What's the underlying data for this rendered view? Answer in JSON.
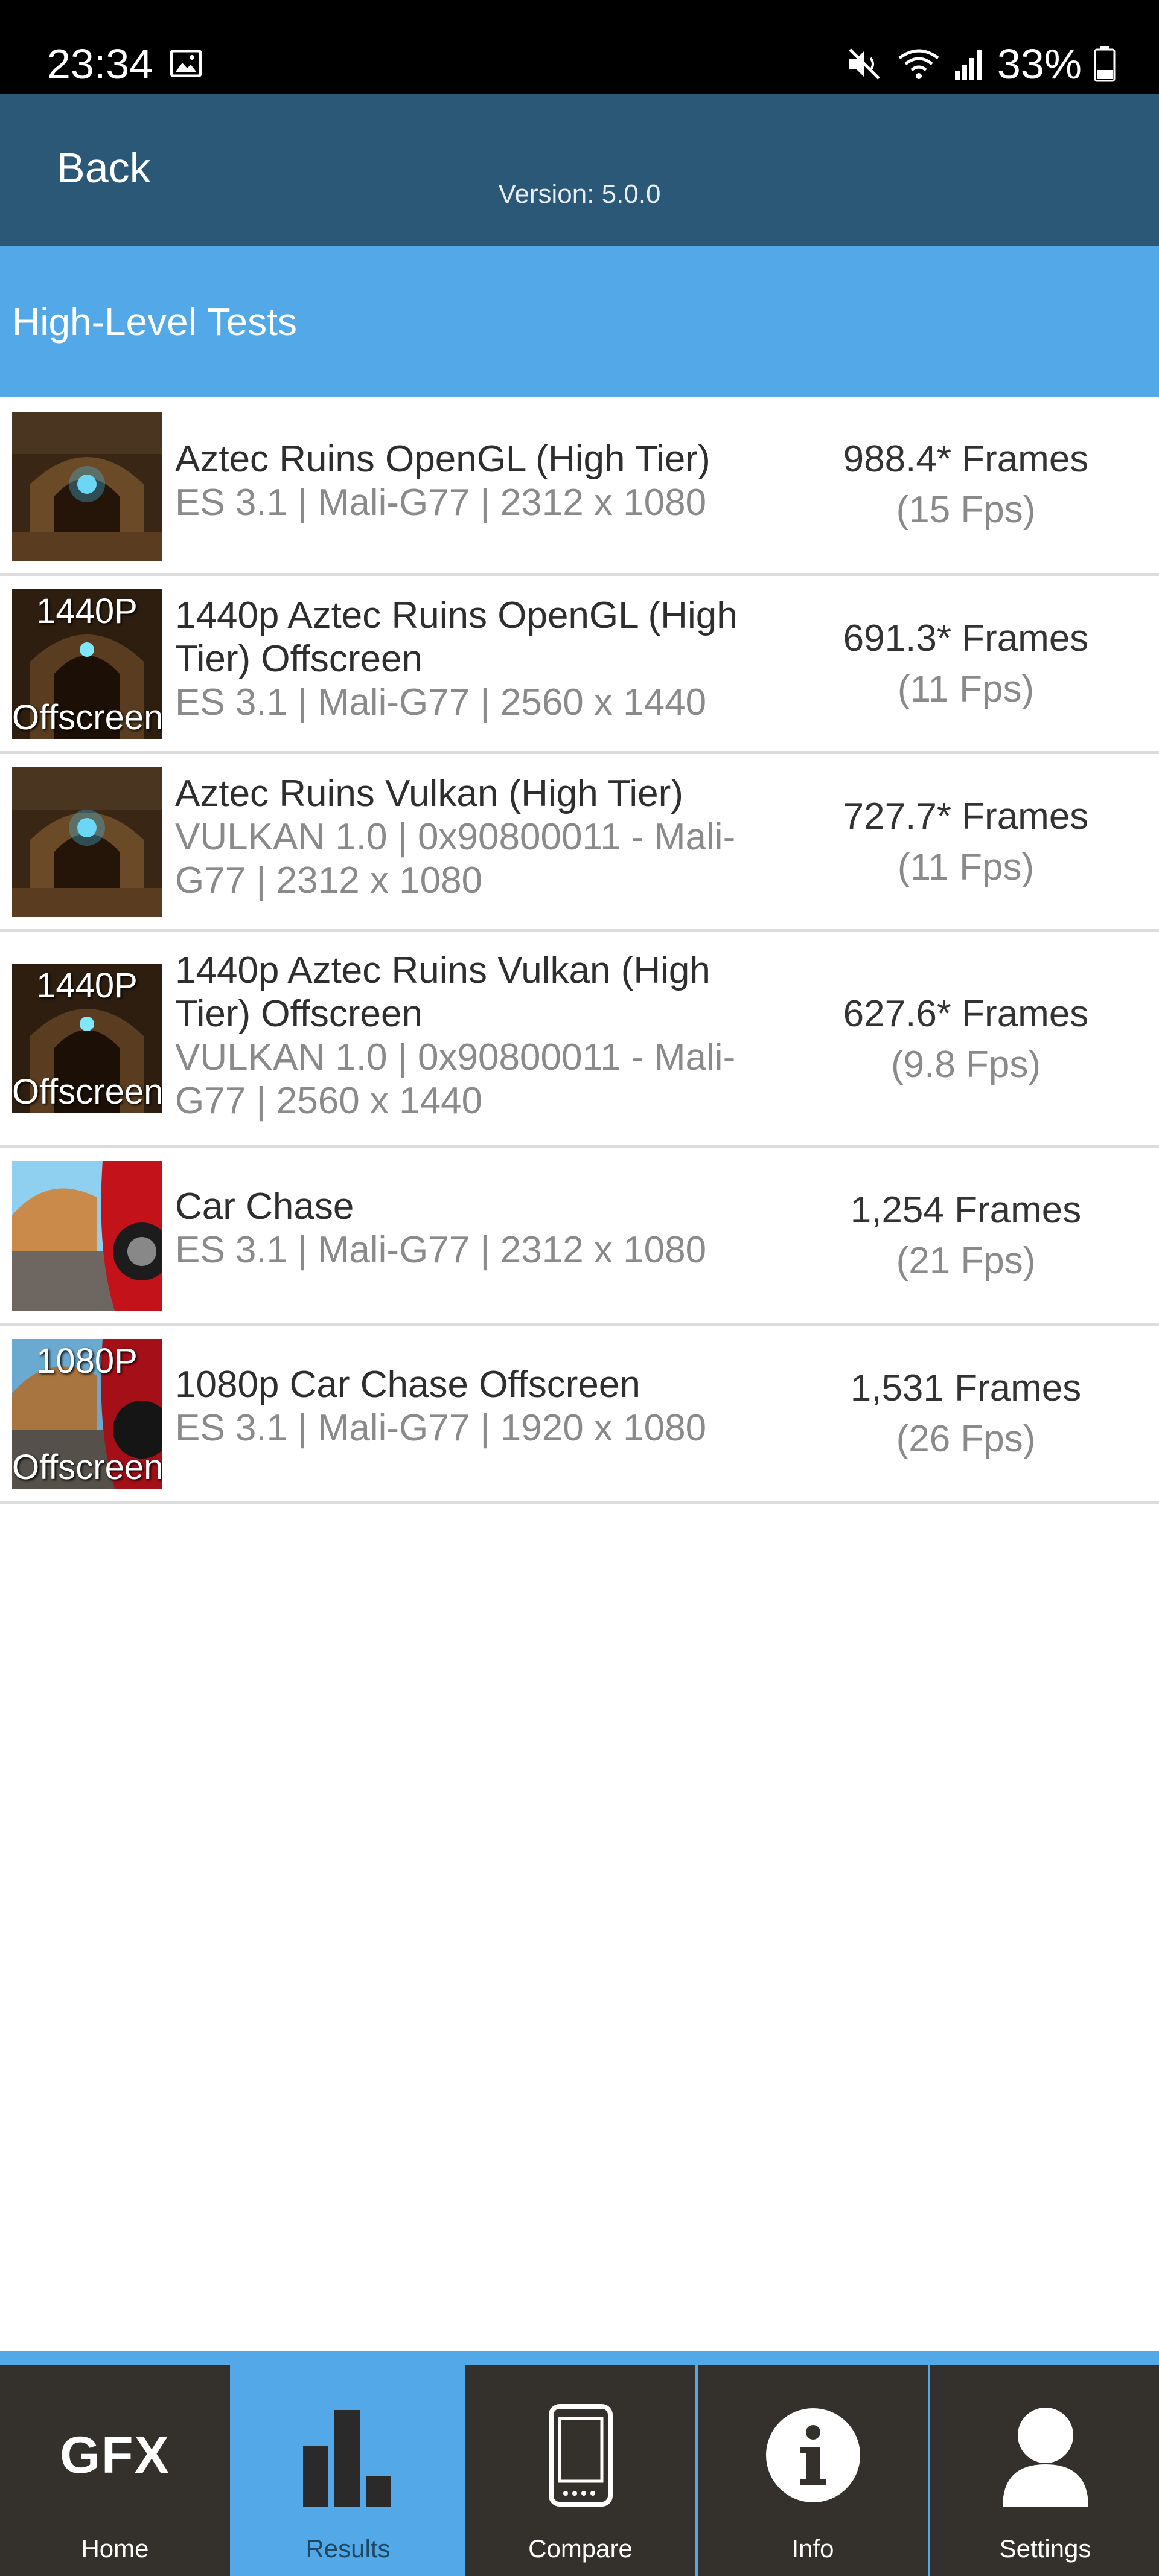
{
  "status_bar": {
    "time": "23:34",
    "battery": "33%",
    "icons": [
      "gallery-icon",
      "mute-icon",
      "wifi-icon",
      "signal-icon",
      "battery-icon"
    ]
  },
  "header": {
    "back_label": "Back",
    "version": "Version: 5.0.0",
    "background": "#2c5878"
  },
  "section": {
    "title": "High-Level Tests",
    "background": "#53a9e7"
  },
  "tests": [
    {
      "name": "Aztec Ruins OpenGL (High Tier)",
      "details": "ES 3.1 | Mali-G77 | 2312 x 1080",
      "frames": "988.4* Frames",
      "fps": "(15 Fps)",
      "thumb_caption_top": "",
      "thumb_caption_bottom": "",
      "thumb_icon": "aztec-ruins-thumbnail-icon"
    },
    {
      "name": "1440p Aztec Ruins OpenGL (High Tier) Offscreen",
      "details": "ES 3.1 | Mali-G77 | 2560 x 1440",
      "frames": "691.3* Frames",
      "fps": "(11 Fps)",
      "thumb_caption_top": "1440P",
      "thumb_caption_bottom": "Offscreen",
      "thumb_icon": "aztec-ruins-offscreen-thumbnail-icon"
    },
    {
      "name": "Aztec Ruins Vulkan (High Tier)",
      "details": "VULKAN 1.0 | 0x90800011 - Mali-G77 | 2312 x 1080",
      "frames": "727.7* Frames",
      "fps": "(11 Fps)",
      "thumb_caption_top": "",
      "thumb_caption_bottom": "",
      "thumb_icon": "aztec-ruins-thumbnail-icon"
    },
    {
      "name": "1440p Aztec Ruins Vulkan (High Tier) Offscreen",
      "details": "VULKAN 1.0 | 0x90800011 - Mali-G77 | 2560 x 1440",
      "frames": "627.6* Frames",
      "fps": "(9.8 Fps)",
      "thumb_caption_top": "1440P",
      "thumb_caption_bottom": "Offscreen",
      "thumb_icon": "aztec-ruins-offscreen-thumbnail-icon"
    },
    {
      "name": "Car Chase",
      "details": "ES 3.1 | Mali-G77 | 2312 x 1080",
      "frames": "1,254 Frames",
      "fps": "(21 Fps)",
      "thumb_caption_top": "",
      "thumb_caption_bottom": "",
      "thumb_icon": "car-chase-thumbnail-icon"
    },
    {
      "name": "1080p Car Chase Offscreen",
      "details": "ES 3.1 | Mali-G77 | 1920 x 1080",
      "frames": "1,531 Frames",
      "fps": "(26 Fps)",
      "thumb_caption_top": "1080P",
      "thumb_caption_bottom": "Offscreen",
      "thumb_icon": "car-chase-offscreen-thumbnail-icon"
    }
  ],
  "bottom_nav": {
    "active": "Results",
    "items": [
      {
        "label": "Home",
        "logo_text": "GFX",
        "icon": "gfx-logo-icon"
      },
      {
        "label": "Results",
        "icon": "bar-chart-icon"
      },
      {
        "label": "Compare",
        "icon": "phone-icon"
      },
      {
        "label": "Info",
        "icon": "info-icon"
      },
      {
        "label": "Settings",
        "icon": "user-icon"
      }
    ],
    "active_color": "#53a9e7",
    "inactive_color": "#34302b"
  }
}
